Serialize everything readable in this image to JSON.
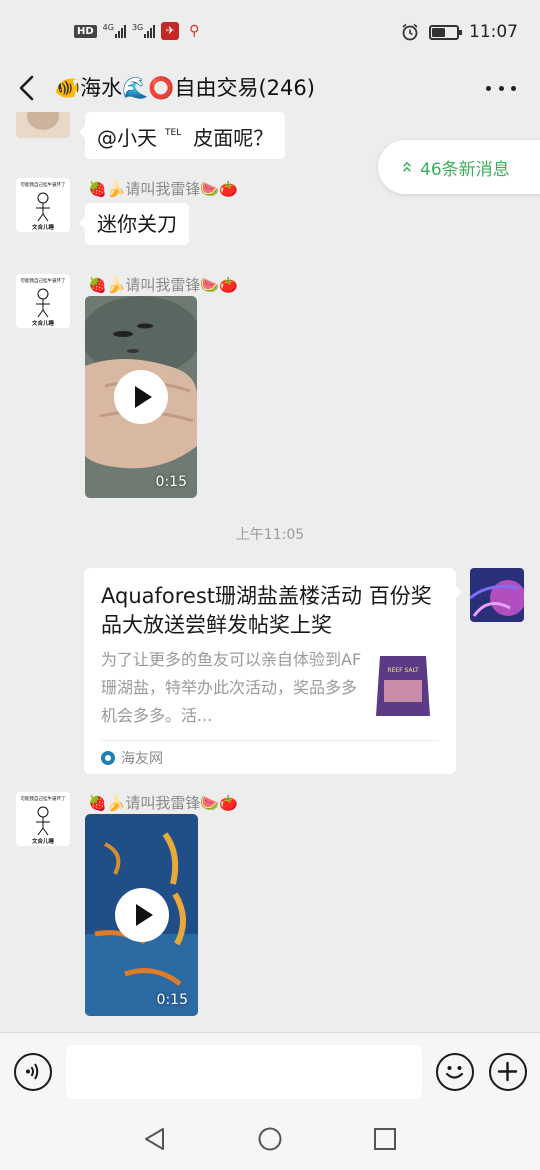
{
  "status_bar": {
    "network_1": "4G",
    "network_2": "3G",
    "hd_label": "HD",
    "sim_1": "1",
    "time": "11:07",
    "battery_level": 0.55
  },
  "header": {
    "title": "🐠海水🌊⭕自由交易(246)",
    "back_icon": "chevron-left-icon",
    "more_icon": "more-horizontal-icon"
  },
  "new_messages": {
    "label": "46条新消息",
    "accent": "#3caf5d"
  },
  "messages": [
    {
      "type": "text",
      "text_main": "@小天",
      "text_tel": "TEL",
      "text_rest": "皮面呢？"
    },
    {
      "type": "text",
      "sender": "🍓🍌请叫我雷锋🍉🍅",
      "avatar_caption_top": "可能我自己挂牛逼坏了",
      "avatar_caption_bottom": "文合儿睡",
      "text": "迷你关刀"
    },
    {
      "type": "video",
      "sender": "🍓🍌请叫我雷锋🍉🍅",
      "avatar_caption_top": "可能我自己挂牛逼坏了",
      "avatar_caption_bottom": "文合儿睡",
      "duration": "0:15"
    },
    {
      "type": "timestamp",
      "text": "上午11:05"
    },
    {
      "type": "link",
      "title": "Aquaforest珊湖盐盖楼活动 百份奖品大放送尝鲜发帖奖上奖",
      "description": "为了让更多的鱼友可以亲自体验到AF珊湖盐，特举办此次活动，奖品多多机会多多。活...",
      "source": "海友网",
      "thumb_label": "REEF SALT"
    },
    {
      "type": "video",
      "sender": "🍓🍌请叫我雷锋🍉🍅",
      "avatar_caption_top": "可能我自己挂牛逼坏了",
      "avatar_caption_bottom": "文合儿睡",
      "duration": "0:15"
    }
  ],
  "input_bar": {
    "voice_icon": "voice-icon",
    "emoji_icon": "emoji-icon",
    "plus_icon": "plus-icon",
    "placeholder": ""
  },
  "system_nav": {
    "back_icon": "triangle-back-icon",
    "home_icon": "circle-home-icon",
    "recents_icon": "square-recents-icon"
  }
}
